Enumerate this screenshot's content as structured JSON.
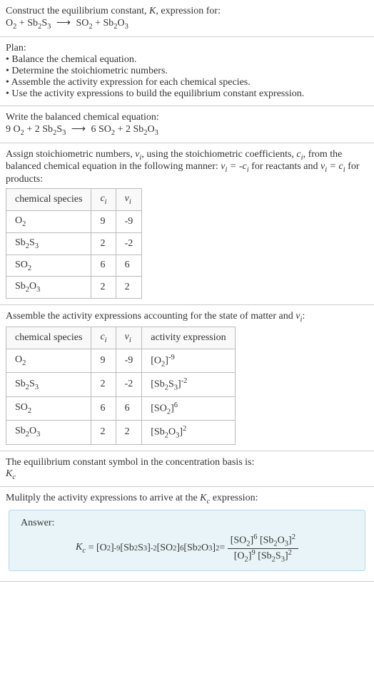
{
  "header": {
    "construct": "Construct the equilibrium constant, ",
    "k": "K",
    "expression_for": ", expression for:",
    "equation": "O₂ + Sb₂S₃ ⟶ SO₂ + Sb₂O₃"
  },
  "plan": {
    "title": "Plan:",
    "bullet1": "• Balance the chemical equation.",
    "bullet2": "• Determine the stoichiometric numbers.",
    "bullet3": "• Assemble the activity expression for each chemical species.",
    "bullet4": "• Use the activity expressions to build the equilibrium constant expression."
  },
  "balanced": {
    "title": "Write the balanced chemical equation:",
    "equation": "9 O₂ + 2 Sb₂S₃ ⟶ 6 SO₂ + 2 Sb₂O₃"
  },
  "assign": {
    "text1": "Assign stoichiometric numbers, ",
    "nu_i": "νᵢ",
    "text2": ", using the stoichiometric coefficients, ",
    "c_i": "cᵢ",
    "text3": ", from the balanced chemical equation in the following manner: ",
    "eq1": "νᵢ = -cᵢ",
    "text4": " for reactants and ",
    "eq2": "νᵢ = cᵢ",
    "text5": " for products:",
    "table": {
      "headers": [
        "chemical species",
        "cᵢ",
        "νᵢ"
      ],
      "rows": [
        [
          "O₂",
          "9",
          "-9"
        ],
        [
          "Sb₂S₃",
          "2",
          "-2"
        ],
        [
          "SO₂",
          "6",
          "6"
        ],
        [
          "Sb₂O₃",
          "2",
          "2"
        ]
      ]
    }
  },
  "activity": {
    "title": "Assemble the activity expressions accounting for the state of matter and νᵢ:",
    "table": {
      "headers": [
        "chemical species",
        "cᵢ",
        "νᵢ",
        "activity expression"
      ],
      "rows": [
        [
          "O₂",
          "9",
          "-9",
          "[O₂]⁻⁹"
        ],
        [
          "Sb₂S₃",
          "2",
          "-2",
          "[Sb₂S₃]⁻²"
        ],
        [
          "SO₂",
          "6",
          "6",
          "[SO₂]⁶"
        ],
        [
          "Sb₂O₃",
          "2",
          "2",
          "[Sb₂O₃]²"
        ]
      ]
    }
  },
  "eq_const": {
    "text": "The equilibrium constant symbol in the concentration basis is:",
    "symbol": "K_c"
  },
  "multiply": {
    "text": "Mulitply the activity expressions to arrive at the ",
    "kc": "K_c",
    "text2": " expression:"
  },
  "answer": {
    "label": "Answer:",
    "kc_eq": "K_c = [O₂]⁻⁹ [Sb₂S₃]⁻² [SO₂]⁶ [Sb₂O₃]² = ",
    "frac_num": "[SO₂]⁶ [Sb₂O₃]²",
    "frac_den": "[O₂]⁹ [Sb₂S₃]²"
  }
}
